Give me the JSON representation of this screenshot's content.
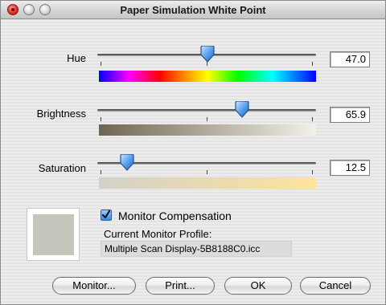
{
  "window": {
    "title": "Paper Simulation White Point"
  },
  "sliders": {
    "hue": {
      "label": "Hue",
      "value": "47.0",
      "position": 0.5
    },
    "brightness": {
      "label": "Brightness",
      "value": "65.9",
      "position": 0.66
    },
    "saturation": {
      "label": "Saturation",
      "value": "12.5",
      "position": 0.13
    }
  },
  "colors": {
    "preview": "#c6c5bb",
    "brightness_bar_start": "#6e6650",
    "brightness_bar_end": "#f3f1e9",
    "saturation_bar_start": "#d3d1c8",
    "saturation_bar_end": "#fde49c",
    "checkbox_accent": "#3d8ae6"
  },
  "compensation": {
    "checkbox_label": "Monitor Compensation",
    "checked": true,
    "profile_heading": "Current Monitor Profile:",
    "profile_name": "Multiple Scan Display-5B8188C0.icc"
  },
  "buttons": {
    "monitor": "Monitor...",
    "print": "Print...",
    "ok": "OK",
    "cancel": "Cancel"
  }
}
